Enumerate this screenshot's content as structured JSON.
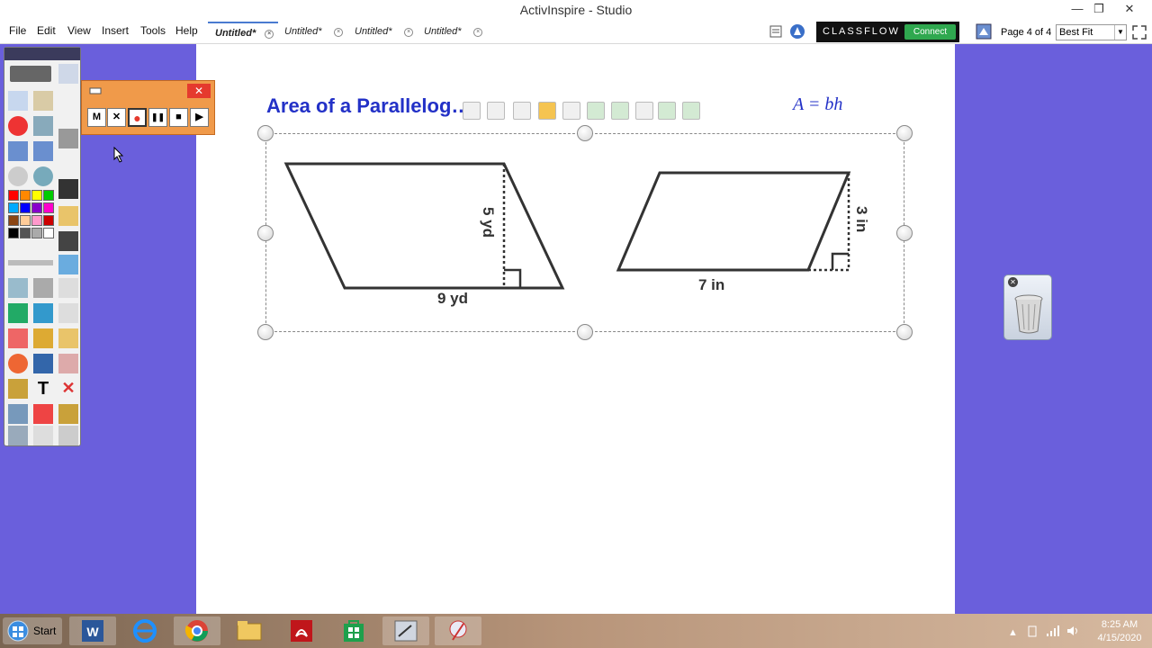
{
  "window": {
    "title": "ActivInspire - Studio",
    "minimize": "—",
    "restore": "❐",
    "close": "✕"
  },
  "menu": {
    "items": [
      "File",
      "Edit",
      "View",
      "Insert",
      "Tools",
      "Help"
    ]
  },
  "tabs": [
    {
      "label": "Untitled*",
      "active": true
    },
    {
      "label": "Untitled*",
      "active": false
    },
    {
      "label": "Untitled*",
      "active": false
    },
    {
      "label": "Untitled*",
      "active": false
    }
  ],
  "classflow": {
    "brand": "CLASSFLOW",
    "connect_label": "Connect"
  },
  "navigation": {
    "page_info": "Page 4 of 4",
    "zoom_value": "Best Fit"
  },
  "toolbox": {
    "palette_colors": [
      "#ff0000",
      "#ff8800",
      "#ffff00",
      "#00cc00",
      "#00aaff",
      "#0000ff",
      "#8800cc",
      "#ff00cc",
      "#8b4513",
      "#ffcc99",
      "#ff99cc",
      "#cc0000",
      "#000000",
      "#555555",
      "#aaaaaa",
      "#ffffff"
    ]
  },
  "recorder": {
    "close": "✕",
    "buttons": [
      "M",
      "✕",
      "●",
      "❚❚",
      "■",
      "▶"
    ]
  },
  "page": {
    "heading": "Area of a Parallelog",
    "heading_obscured_tail": "…",
    "formula": "A = bh",
    "figure1": {
      "height_label": "5 yd",
      "base_label": "9 yd"
    },
    "figure2": {
      "height_label": "3 in",
      "base_label": "7 in"
    }
  },
  "trash": {
    "close": "✕"
  },
  "taskbar": {
    "start_label": "Start",
    "time": "8:25 AM",
    "date": "4/15/2020"
  },
  "colors": {
    "background": "#6a5fdc",
    "heading": "#2331c7",
    "recorder": "#f09a4a",
    "record_red": "#e53a2e"
  }
}
